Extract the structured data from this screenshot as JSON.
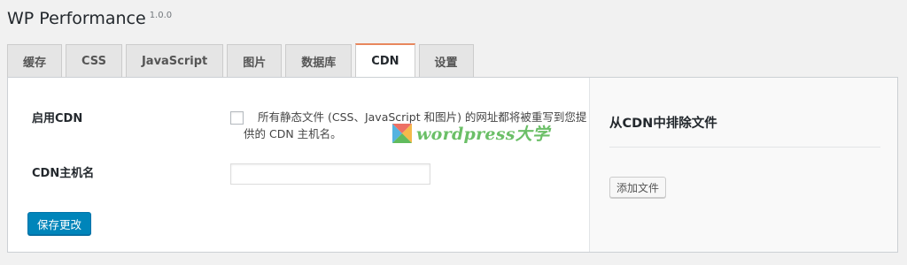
{
  "header": {
    "title": "WP Performance",
    "version": "1.0.0"
  },
  "tabs": [
    {
      "label": "缓存",
      "active": false
    },
    {
      "label": "CSS",
      "active": false
    },
    {
      "label": "JavaScript",
      "active": false
    },
    {
      "label": "图片",
      "active": false
    },
    {
      "label": "数据库",
      "active": false
    },
    {
      "label": "CDN",
      "active": true
    },
    {
      "label": "设置",
      "active": false
    }
  ],
  "accent_color": "#e8875d",
  "cdn_form": {
    "enable_label": "启用CDN",
    "enable_checked": false,
    "enable_description": "所有静态文件 (CSS、JavaScript 和图片) 的网址都将被重写到您提供的 CDN 主机名。",
    "hostname_label": "CDN主机名",
    "hostname_value": "",
    "save_button": "保存更改",
    "save_button_color": "#0085ba"
  },
  "watermark": {
    "text": "wordpress大学"
  },
  "sidebar": {
    "title": "从CDN中排除文件",
    "add_button": "添加文件"
  }
}
